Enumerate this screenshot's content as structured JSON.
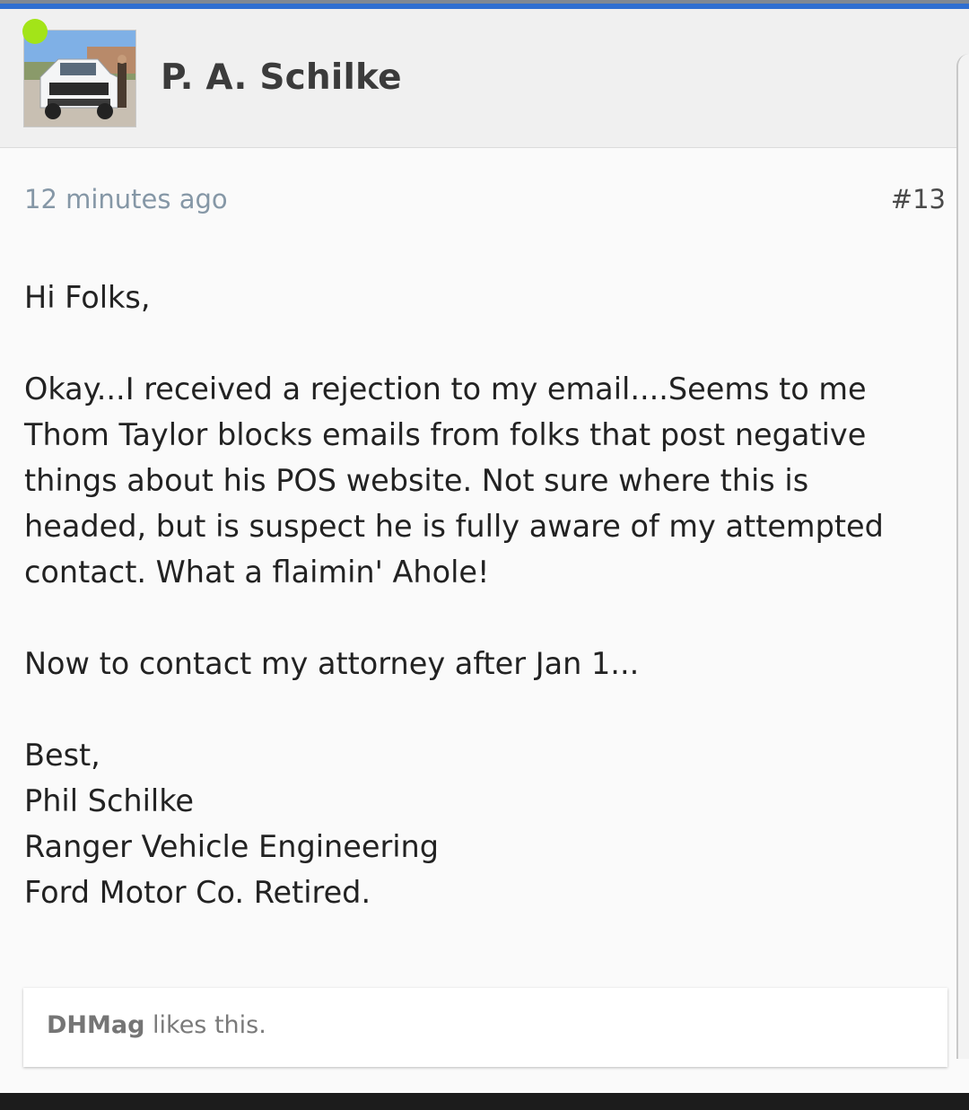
{
  "colors": {
    "accent_bar": "#2f6fd1",
    "online_indicator": "#a3e418",
    "timestamp": "#8597a6",
    "background": "#fafafa",
    "header_background": "#f0f0f0"
  },
  "post": {
    "author": "P. A. Schilke",
    "avatar": "profile-photo-white-pickup-truck",
    "status": "online",
    "timestamp": "12 minutes ago",
    "number": "#13",
    "body": {
      "greeting": "Hi Folks,",
      "paragraph1": [
        "Okay...I received a rejection to my email....Seems to me",
        "Thom Taylor blocks emails from folks that post negative",
        "things about his POS website. Not sure where this is",
        "headed, but is suspect he is fully aware of my attempted",
        "contact. What a flaimin' Ahole!"
      ],
      "paragraph2": "Now to contact my attorney after Jan 1...",
      "signature": [
        "Best,",
        "Phil Schilke",
        "Ranger Vehicle Engineering",
        "Ford Motor Co. Retired."
      ]
    },
    "likes": {
      "user": "DHMag",
      "suffix": " likes this."
    }
  }
}
